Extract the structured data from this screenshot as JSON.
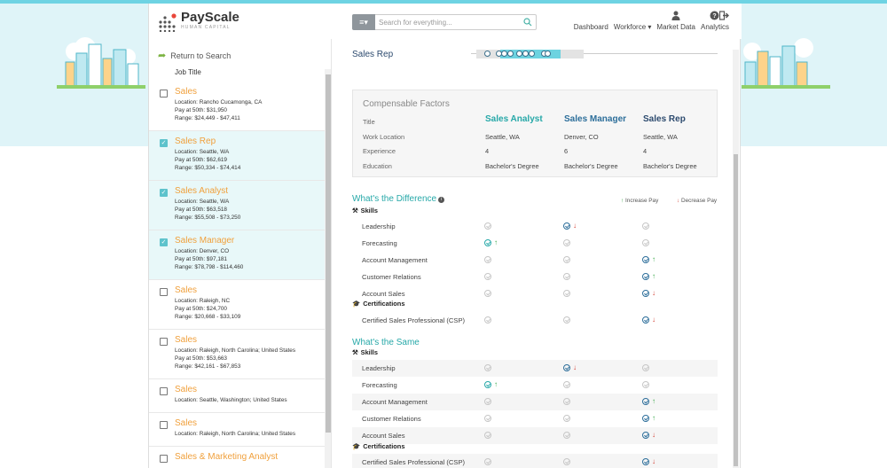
{
  "header": {
    "logo_text": "PayScale",
    "logo_sub": "HUMAN CAPITAL",
    "search_placeholder": "Search for everything...",
    "nav": [
      {
        "label": "Dashboard",
        "icon": "none"
      },
      {
        "label": "Workforce ▾",
        "icon": "none"
      },
      {
        "label": "Market Data",
        "icon": "user-icon"
      },
      {
        "label": "Analytics",
        "icon": "help-icon"
      }
    ],
    "signout_icon": "signout-icon"
  },
  "sidebar": {
    "return_label": "Return to Search",
    "column_header": "Job Title",
    "jobs": [
      {
        "title": "Sales",
        "checked": false,
        "location": "Location: Rancho Cucamonga, CA",
        "pay": "Pay at 50th: $31,950",
        "range": "Range: $24,449 - $47,411"
      },
      {
        "title": "Sales Rep",
        "checked": true,
        "location": "Location: Seattle, WA",
        "pay": "Pay at 50th: $62,619",
        "range": "Range: $50,334 - $74,414"
      },
      {
        "title": "Sales Analyst",
        "checked": true,
        "location": "Location: Seattle, WA",
        "pay": "Pay at 50th: $63,518",
        "range": "Range: $55,508 - $73,250"
      },
      {
        "title": "Sales Manager",
        "checked": true,
        "location": "Location: Denver, CO",
        "pay": "Pay at 50th: $97,181",
        "range": "Range: $78,798 - $114,460"
      },
      {
        "title": "Sales",
        "checked": false,
        "location": "Location: Raleigh, NC",
        "pay": "Pay at 50th: $24,700",
        "range": "Range: $20,668 - $33,109"
      },
      {
        "title": "Sales",
        "checked": false,
        "location": "Location: Raleigh, North Carolina; United States",
        "pay": "Pay at 50th: $53,663",
        "range": "Range: $42,161 - $67,853"
      },
      {
        "title": "Sales",
        "checked": false,
        "location": "Location: Seattle, Washington; United States",
        "pay": "",
        "range": ""
      },
      {
        "title": "Sales",
        "checked": false,
        "location": "Location: Raleigh, North Carolina; United States",
        "pay": "",
        "range": ""
      },
      {
        "title": "Sales & Marketing Analyst",
        "checked": false,
        "location": "",
        "pay": "",
        "range": ""
      }
    ]
  },
  "main": {
    "title": "Sales Rep",
    "factors": {
      "title": "Compensable Factors",
      "labels": [
        "Title",
        "Work Location",
        "Experience",
        "Education"
      ],
      "columns": [
        {
          "title": "Sales Analyst",
          "color": "#26a8a8",
          "location": "Seattle, WA",
          "experience": "4",
          "education": "Bachelor's Degree"
        },
        {
          "title": "Sales Manager",
          "color": "#2c6e9a",
          "location": "Denver, CO",
          "experience": "6",
          "education": "Bachelor's Degree"
        },
        {
          "title": "Sales Rep",
          "color": "#2c4a6e",
          "location": "Seattle, WA",
          "experience": "4",
          "education": "Bachelor's Degree"
        }
      ]
    },
    "legend": {
      "increase": "Increase Pay",
      "decrease": "Decrease Pay"
    },
    "difference": {
      "title": "What's the Difference",
      "skills_label": "Skills",
      "certs_label": "Certifications"
    },
    "same": {
      "title": "What's the Same",
      "skills_label": "Skills",
      "certs_label": "Certifications"
    },
    "rows": [
      {
        "label": "Leadership",
        "cells": [
          "none",
          "down",
          "none"
        ]
      },
      {
        "label": "Forecasting",
        "cells": [
          "up",
          "none",
          "none"
        ]
      },
      {
        "label": "Account Management",
        "cells": [
          "none",
          "none",
          "up"
        ]
      },
      {
        "label": "Customer Relations",
        "cells": [
          "none",
          "none",
          "up"
        ]
      },
      {
        "label": "Account Sales",
        "cells": [
          "none",
          "none",
          "down"
        ]
      }
    ],
    "cert_rows": [
      {
        "label": "Certified Sales Professional (CSP)",
        "cells": [
          "none",
          "none",
          "down"
        ]
      }
    ]
  }
}
